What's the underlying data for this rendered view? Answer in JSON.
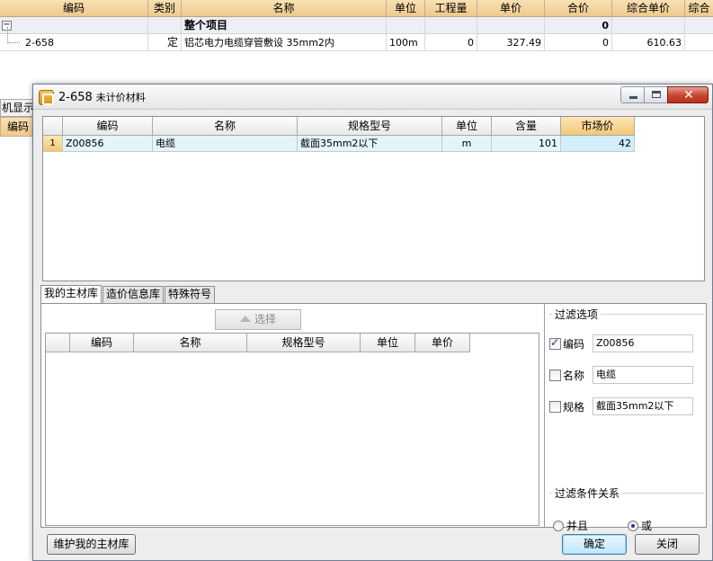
{
  "background_grid": {
    "columns": [
      "编码",
      "类别",
      "名称",
      "单位",
      "工程量",
      "单价",
      "合价",
      "综合单价",
      "综合"
    ],
    "rows": [
      {
        "toggle": "−",
        "code": "",
        "type": "",
        "name": "整个项目",
        "unit": "",
        "qty": "",
        "price": "",
        "total": "0",
        "comp_price": "",
        "comp": ""
      },
      {
        "toggle": "",
        "code": "2-658",
        "type": "定",
        "name": "铝芯电力电缆穿管敷设 35mm2内",
        "unit": "100m",
        "qty": "0",
        "price": "327.49",
        "total": "0",
        "comp_price": "610.63",
        "comp": ""
      }
    ],
    "left_tab_label": "机显示",
    "left_cell_label": "编码"
  },
  "dialog": {
    "title_code": "2-658",
    "title_sub": "未计价材料",
    "close_symbol": "✕",
    "material_grid": {
      "columns": [
        "编码",
        "名称",
        "规格型号",
        "单位",
        "含量",
        "市场价"
      ],
      "rows": [
        {
          "row_no": "1",
          "code": "Z00856",
          "name": "电缆",
          "spec": "截面35mm2以下",
          "unit": "m",
          "content": "101",
          "market_price": "42"
        }
      ]
    },
    "tabs": [
      "我的主材库",
      "造价信息库",
      "特殊符号"
    ],
    "select_label": "选择",
    "library_grid_columns": [
      "编码",
      "名称",
      "规格型号",
      "单位",
      "单价"
    ],
    "filter": {
      "title": "过滤选项",
      "code_label": "编码",
      "code_value": "Z00856",
      "name_label": "名称",
      "name_value": "电缆",
      "spec_label": "规格",
      "spec_value": "截面35mm2以下"
    },
    "relation": {
      "title": "过滤条件关系",
      "and_label": "并且",
      "or_label": "或"
    },
    "buttons": {
      "maintain": "维护我的主材库",
      "ok": "确定",
      "close": "关闭"
    }
  }
}
